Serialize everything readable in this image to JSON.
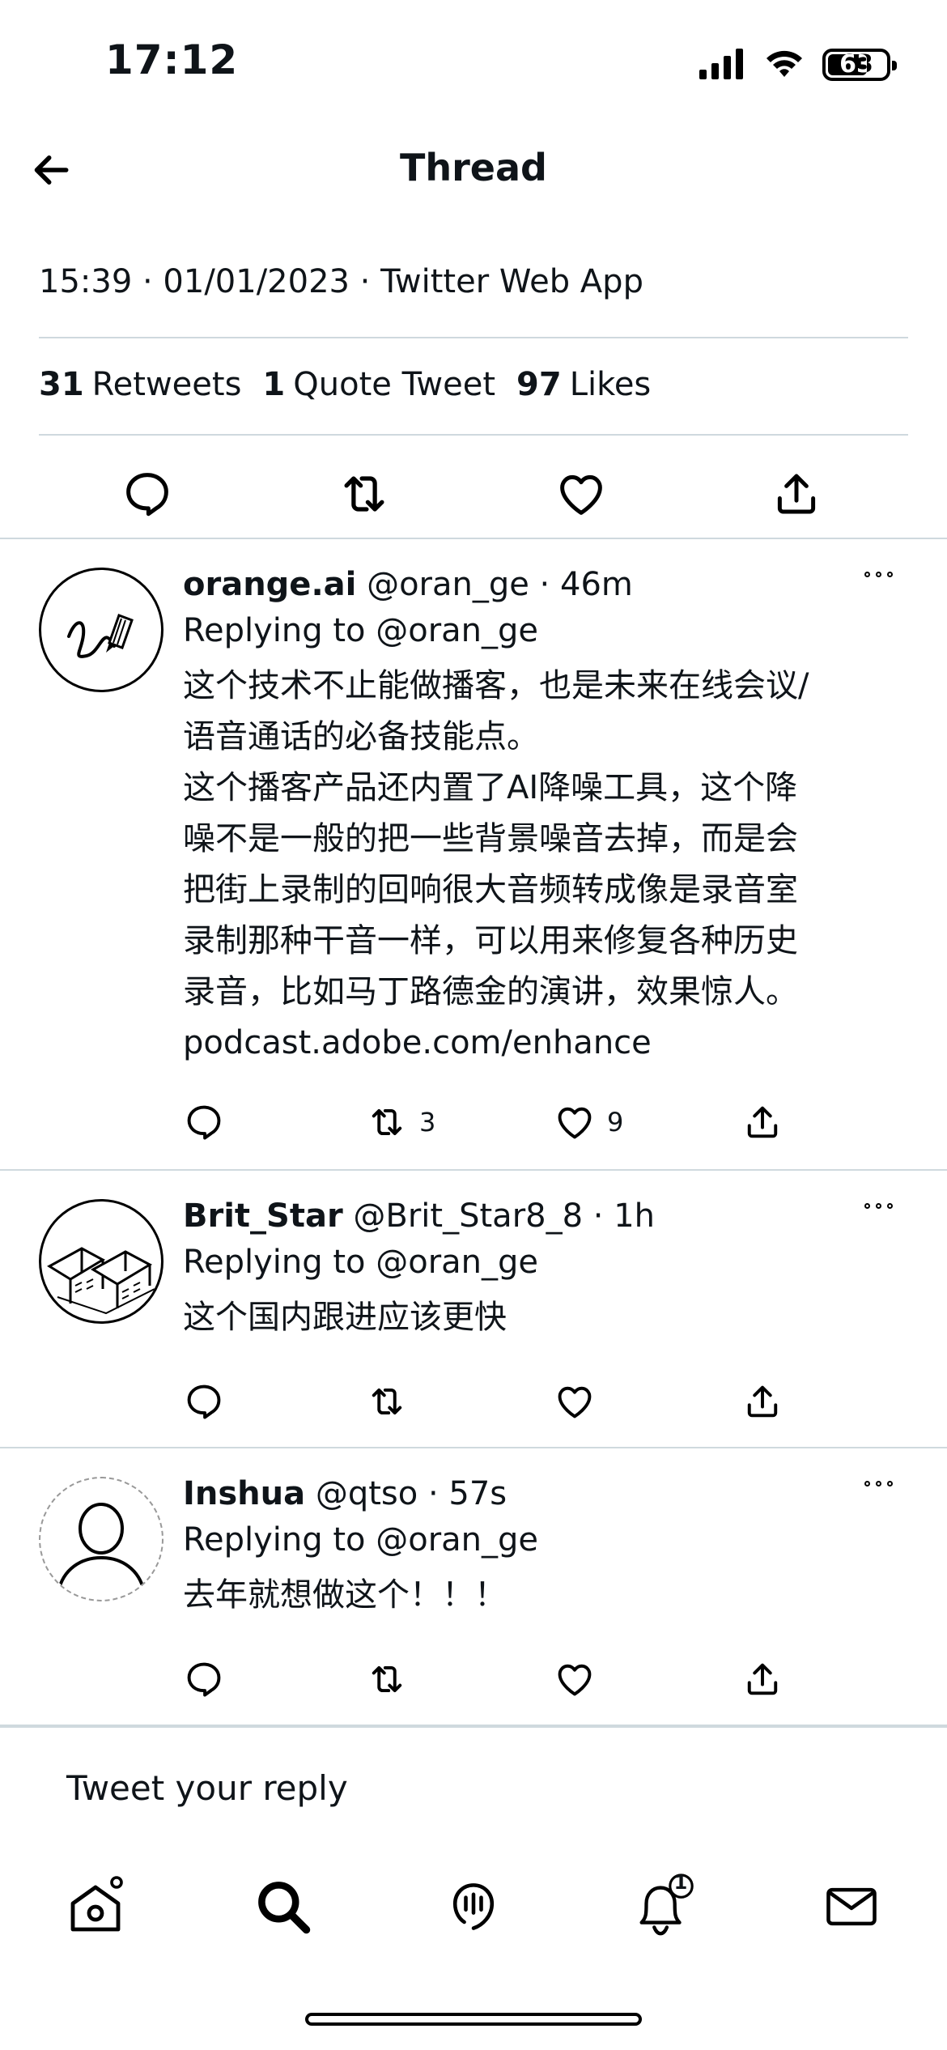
{
  "status_bar": {
    "time": "17:12",
    "battery": "63"
  },
  "nav": {
    "title": "Thread"
  },
  "tweet": {
    "meta": "15:39 · 01/01/2023 · Twitter Web App",
    "retweets_count": "31",
    "retweets_label": "Retweets",
    "quotes_count": "1",
    "quotes_label": "Quote Tweet",
    "likes_count": "97",
    "likes_label": "Likes"
  },
  "replies": [
    {
      "name": "orange.ai",
      "handle": "@oran_ge",
      "time": "46m",
      "replying_prefix": "Replying to",
      "replying_to": "@oran_ge",
      "text": "这个技术不止能做播客，也是未来在线会议/\n语音通话的必备技能点。\n这个播客产品还内置了AI降噪工具，这个降\n噪不是一般的把一些背景噪音去掉，而是会\n把街上录制的回响很大音频转成像是录音室\n录制那种干音一样，可以用来修复各种历史\n录音，比如马丁路德金的演讲，效果惊人。",
      "link": "podcast.adobe.com/enhance",
      "retweets": "3",
      "likes": "9"
    },
    {
      "name": "Brit_Star",
      "handle": "@Brit_Star8_8",
      "time": "1h",
      "replying_prefix": "Replying to",
      "replying_to": "@oran_ge",
      "text": "这个国内跟进应该更快",
      "retweets": "",
      "likes": ""
    },
    {
      "name": "Inshua",
      "handle": "@qtso",
      "time": "57s",
      "replying_prefix": "Replying to",
      "replying_to": "@oran_ge",
      "text": "去年就想做这个！！！",
      "retweets": "",
      "likes": ""
    }
  ],
  "compose": {
    "placeholder": "Tweet your reply"
  },
  "tab_bar": {
    "notification_count": "1"
  },
  "icons": [
    "signal-icon",
    "wifi-icon",
    "battery-icon",
    "back-arrow-icon",
    "reply-icon",
    "retweet-icon",
    "like-icon",
    "share-icon",
    "more-icon",
    "home-icon",
    "search-icon",
    "spaces-icon",
    "notifications-icon",
    "messages-icon"
  ]
}
